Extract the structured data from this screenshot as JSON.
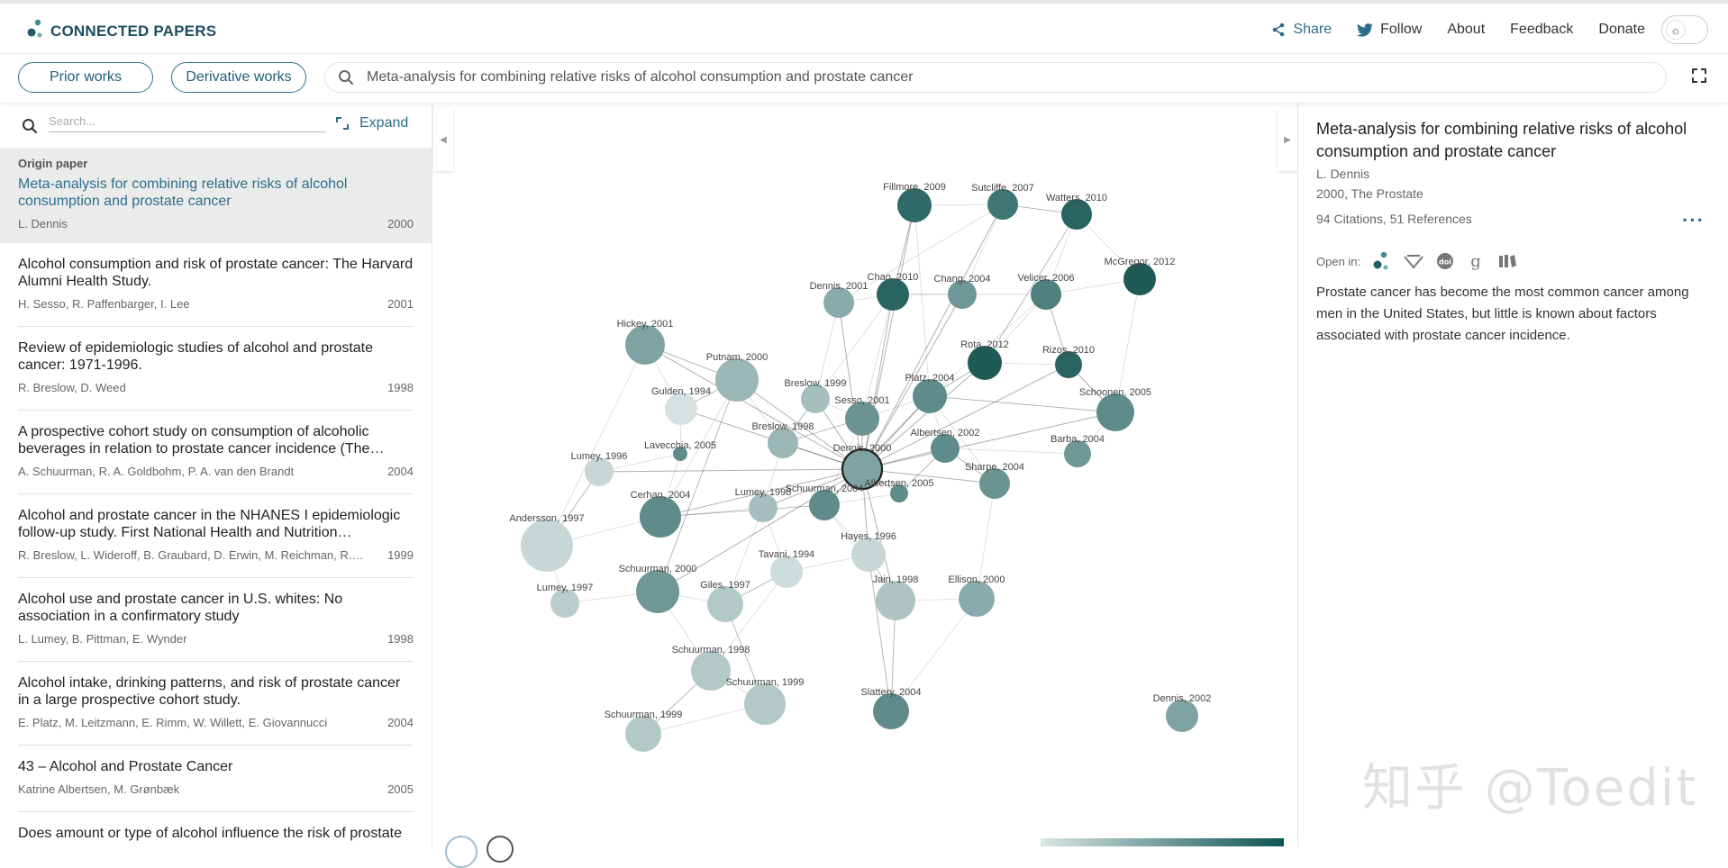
{
  "app": {
    "title": "CONNECTED PAPERS",
    "brand_color": "#1e4e63",
    "accent_color": "#2d6e8c"
  },
  "nav": {
    "share": "Share",
    "follow": "Follow",
    "about": "About",
    "feedback": "Feedback",
    "donate": "Donate"
  },
  "toolbar": {
    "prior": "Prior works",
    "derivative": "Derivative works",
    "search_value": "Meta-analysis for combining relative risks of alcohol consumption and prostate cancer"
  },
  "sidebar": {
    "search_placeholder": "Search...",
    "expand": "Expand",
    "origin": {
      "tag": "Origin paper",
      "title": "Meta-analysis for combining relative risks of alcohol consumption and prostate cancer",
      "authors": "L. Dennis",
      "year": "2000"
    },
    "items": [
      {
        "title": "Alcohol consumption and risk of prostate cancer: The Harvard Alumni Health Study.",
        "authors": "H. Sesso, R. Paffenbarger, I. Lee",
        "year": "2001"
      },
      {
        "title": "Review of epidemiologic studies of alcohol and prostate cancer: 1971-1996.",
        "authors": "R. Breslow, D. Weed",
        "year": "1998"
      },
      {
        "title": "A prospective cohort study on consumption of alcoholic beverages in relation to prostate cancer incidence (The…",
        "authors": "A. Schuurman, R. A. Goldbohm, P. A. van den Brandt",
        "year": "2004"
      },
      {
        "title": "Alcohol and prostate cancer in the NHANES I epidemiologic follow-up study. First National Health and Nutrition…",
        "authors": "R. Breslow, L. Wideroff, B. Graubard, D. Erwin, M. Reichman, R.…",
        "year": "1999"
      },
      {
        "title": "Alcohol use and prostate cancer in U.S. whites: No association in a confirmatory study",
        "authors": "L. Lumey, B. Pittman, E. Wynder",
        "year": "1998"
      },
      {
        "title": "Alcohol intake, drinking patterns, and risk of prostate cancer in a large prospective cohort study.",
        "authors": "E. Platz, M. Leitzmann, E. Rimm, W. Willett, E. Giovannucci",
        "year": "2004"
      },
      {
        "title": "43 – Alcohol and Prostate Cancer",
        "authors": "Katrine Albertsen, M. Grønbæk",
        "year": "2005"
      },
      {
        "title": "Does amount or type of alcohol influence the risk of prostate",
        "authors": "",
        "year": ""
      }
    ]
  },
  "detail": {
    "title": "Meta-analysis for combining relative risks of alcohol consumption and prostate cancer",
    "authors": "L. Dennis",
    "venue": "2000, The Prostate",
    "citations": "94 Citations, 51 References",
    "open_in": "Open in:",
    "abstract": "Prostate cancer has become the most common cancer among men in the United States, but little is known about factors associated with prostate cancer incidence."
  },
  "watermark": "知乎 @Toedit",
  "graph": {
    "nodes": [
      {
        "label": "Fillmore, 2009",
        "color": "#2f6a68"
      },
      {
        "label": "Sutcliffe, 2007",
        "color": "#3f7775"
      },
      {
        "label": "Watters, 2010",
        "color": "#2a6461"
      },
      {
        "label": "McGregor, 2012",
        "color": "#1f5a57"
      },
      {
        "label": "Dennis, 2001",
        "color": "#8aabab"
      },
      {
        "label": "Chao, 2010",
        "color": "#2a6461"
      },
      {
        "label": "Chang, 2004",
        "color": "#6f9796"
      },
      {
        "label": "Velicer, 2006",
        "color": "#4d807e"
      },
      {
        "label": "Hickey, 2001",
        "color": "#7fa3a2"
      },
      {
        "label": "Rota, 2012",
        "color": "#1f5a57"
      },
      {
        "label": "Rizos, 2010",
        "color": "#2a6461"
      },
      {
        "label": "Putnam, 2000",
        "color": "#9bb7b6"
      },
      {
        "label": "Breslow, 1999",
        "color": "#a5bfbe"
      },
      {
        "label": "Platz, 2004",
        "color": "#5f8c8a"
      },
      {
        "label": "Gulden, 1994",
        "color": "#d5e2e1"
      },
      {
        "label": "Sesso, 2001",
        "color": "#6b9392"
      },
      {
        "label": "Schoonen, 2005",
        "color": "#5f8c8a"
      },
      {
        "label": "Lavecchia, 2005",
        "color": "#5f8c8a"
      },
      {
        "label": "Breslow, 1998",
        "color": "#9bb7b6"
      },
      {
        "label": "Albertsen, 2002",
        "color": "#5f8c8a"
      },
      {
        "label": "Barba, 2004",
        "color": "#6f9796"
      },
      {
        "label": "Lumey, 1996",
        "color": "#c6d7d6"
      },
      {
        "label": "Dennis, 2000",
        "color": "#7fa3a2"
      },
      {
        "label": "Sharpe, 2004",
        "color": "#6b9392"
      },
      {
        "label": "Albertsen, 2005",
        "color": "#5f8c8a"
      },
      {
        "label": "Lumey, 1998",
        "color": "#a5bfbe"
      },
      {
        "label": "Schuurman, 2004",
        "color": "#5f8c8a"
      },
      {
        "label": "Cerhan, 2004",
        "color": "#5f8c8a"
      },
      {
        "label": "Andersson, 1997",
        "color": "#c6d7d6"
      },
      {
        "label": "Hayes, 1996",
        "color": "#c6d7d6"
      },
      {
        "label": "Tavani, 1994",
        "color": "#ccdcdb"
      },
      {
        "label": "Schuurman, 2000",
        "color": "#6f9796"
      },
      {
        "label": "Giles, 1997",
        "color": "#b3c9c8"
      },
      {
        "label": "Lumey, 1997",
        "color": "#b9cdcc"
      },
      {
        "label": "Jain, 1998",
        "color": "#adc4c3"
      },
      {
        "label": "Ellison, 2000",
        "color": "#8aabab"
      },
      {
        "label": "Schuurman, 1998",
        "color": "#b3c9c8"
      },
      {
        "label": "Schuurman, 1999",
        "color": "#b3c9c8"
      },
      {
        "label": "Slattery, 2004",
        "color": "#5f8c8a"
      },
      {
        "label": "Schuurman, 1999",
        "color": "#b3c9c8"
      },
      {
        "label": "Dennis, 2002",
        "color": "#7fa3a2"
      }
    ]
  }
}
